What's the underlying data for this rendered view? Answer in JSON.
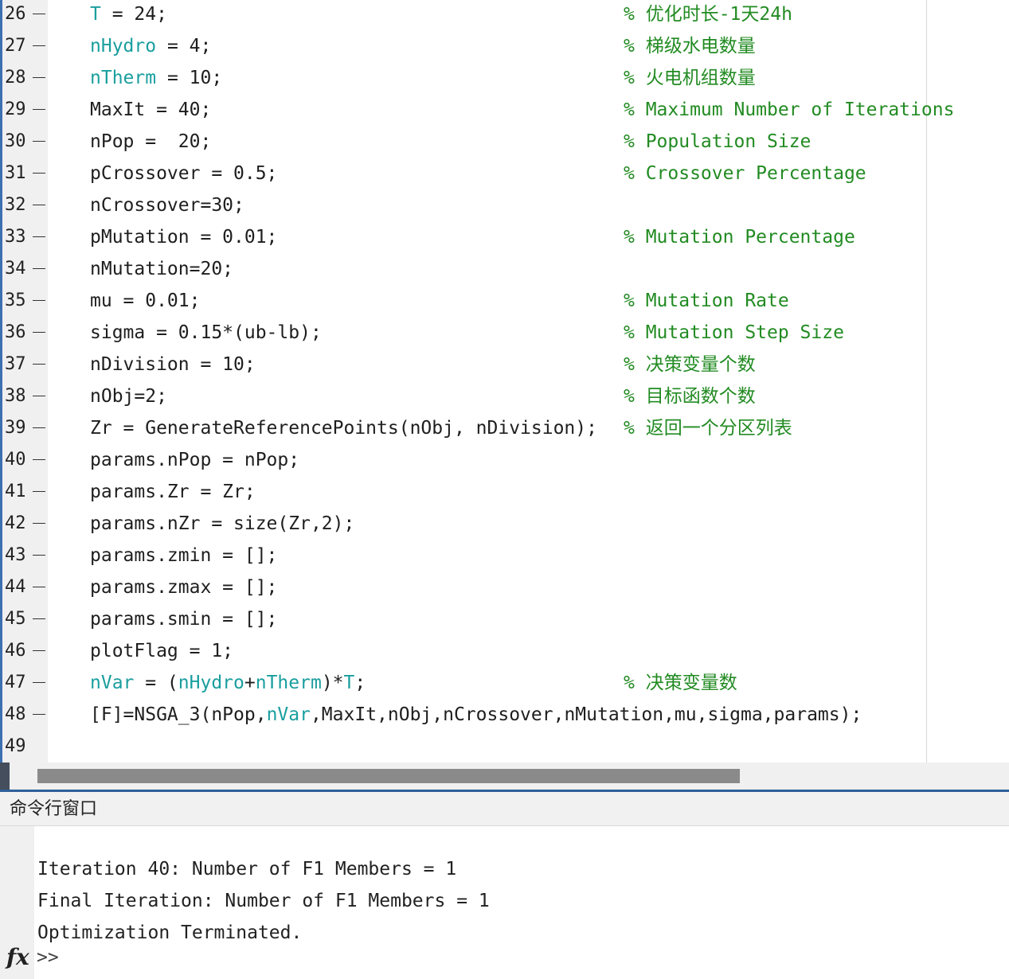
{
  "editor": {
    "lines": [
      {
        "num": "26",
        "segments": [
          {
            "t": "T",
            "c": "var"
          },
          {
            "t": " = 24;",
            "c": "code"
          }
        ],
        "comment": "% 优化时长-1天24h"
      },
      {
        "num": "27",
        "segments": [
          {
            "t": "nHydro",
            "c": "var"
          },
          {
            "t": " = 4;",
            "c": "code"
          }
        ],
        "comment": "% 梯级水电数量"
      },
      {
        "num": "28",
        "segments": [
          {
            "t": "nTherm",
            "c": "var"
          },
          {
            "t": " = 10;",
            "c": "code"
          }
        ],
        "comment": "% 火电机组数量"
      },
      {
        "num": "29",
        "segments": [
          {
            "t": "MaxIt = 40;",
            "c": "code"
          }
        ],
        "comment": "% Maximum Number of Iterations"
      },
      {
        "num": "30",
        "segments": [
          {
            "t": "nPop =  20;",
            "c": "code"
          }
        ],
        "comment": "% Population Size"
      },
      {
        "num": "31",
        "segments": [
          {
            "t": "pCrossover = 0.5;",
            "c": "code"
          }
        ],
        "comment": "% Crossover Percentage"
      },
      {
        "num": "32",
        "segments": [
          {
            "t": "nCrossover=30;",
            "c": "code"
          }
        ],
        "comment": ""
      },
      {
        "num": "33",
        "segments": [
          {
            "t": "pMutation = 0.01;",
            "c": "code"
          }
        ],
        "comment": "% Mutation Percentage"
      },
      {
        "num": "34",
        "segments": [
          {
            "t": "nMutation=20;",
            "c": "code"
          }
        ],
        "comment": ""
      },
      {
        "num": "35",
        "segments": [
          {
            "t": "mu = 0.01;",
            "c": "code"
          }
        ],
        "comment": "% Mutation Rate"
      },
      {
        "num": "36",
        "segments": [
          {
            "t": "sigma = 0.15*(ub-lb);",
            "c": "code"
          }
        ],
        "comment": "% Mutation Step Size"
      },
      {
        "num": "37",
        "segments": [
          {
            "t": "nDivision = 10;",
            "c": "code"
          }
        ],
        "comment": "% 决策变量个数"
      },
      {
        "num": "38",
        "segments": [
          {
            "t": "nObj=2;",
            "c": "code"
          }
        ],
        "comment": "% 目标函数个数"
      },
      {
        "num": "39",
        "segments": [
          {
            "t": "Zr = GenerateReferencePoints(nObj, nDivision);",
            "c": "code"
          }
        ],
        "comment": "% 返回一个分区列表"
      },
      {
        "num": "40",
        "segments": [
          {
            "t": "params.nPop = nPop;",
            "c": "code"
          }
        ],
        "comment": ""
      },
      {
        "num": "41",
        "segments": [
          {
            "t": "params.Zr = Zr;",
            "c": "code"
          }
        ],
        "comment": ""
      },
      {
        "num": "42",
        "segments": [
          {
            "t": "params.nZr = size(Zr,2);",
            "c": "code"
          }
        ],
        "comment": ""
      },
      {
        "num": "43",
        "segments": [
          {
            "t": "params.zmin = [];",
            "c": "code"
          }
        ],
        "comment": ""
      },
      {
        "num": "44",
        "segments": [
          {
            "t": "params.zmax = [];",
            "c": "code"
          }
        ],
        "comment": ""
      },
      {
        "num": "45",
        "segments": [
          {
            "t": "params.smin = [];",
            "c": "code"
          }
        ],
        "comment": ""
      },
      {
        "num": "46",
        "segments": [
          {
            "t": "plotFlag = 1;",
            "c": "code"
          }
        ],
        "comment": ""
      },
      {
        "num": "47",
        "segments": [
          {
            "t": "nVar",
            "c": "var"
          },
          {
            "t": " = (",
            "c": "code"
          },
          {
            "t": "nHydro",
            "c": "var"
          },
          {
            "t": "+",
            "c": "code"
          },
          {
            "t": "nTherm",
            "c": "var"
          },
          {
            "t": ")*",
            "c": "code"
          },
          {
            "t": "T",
            "c": "var"
          },
          {
            "t": ";",
            "c": "code"
          }
        ],
        "comment": "% 决策变量数"
      },
      {
        "num": "48",
        "segments": [
          {
            "t": "[F]=NSGA_3(nPop,",
            "c": "code"
          },
          {
            "t": "nVar",
            "c": "var"
          },
          {
            "t": ",MaxIt,nObj,nCrossover,nMutation,mu,sigma,params);",
            "c": "code"
          }
        ],
        "comment": ""
      },
      {
        "num": "49",
        "segments": [],
        "comment": "",
        "nodash": true
      }
    ]
  },
  "command_window": {
    "title": "命令行窗口",
    "output": [
      "Iteration 40: Number of F1 Members = 1",
      "Final Iteration: Number of F1 Members = 1",
      "Optimization Terminated."
    ],
    "fx_label": "fx",
    "prompt": ">>"
  }
}
